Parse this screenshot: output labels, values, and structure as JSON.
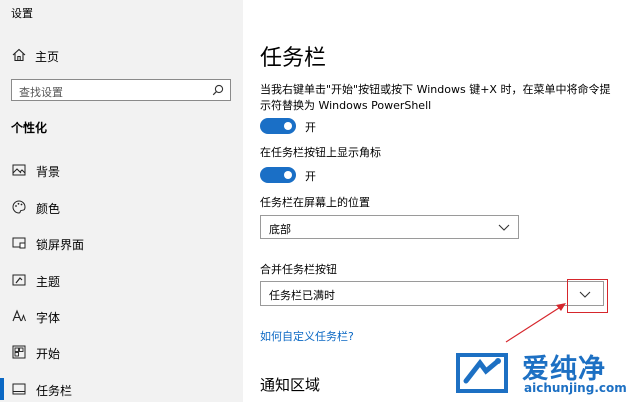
{
  "window": {
    "title": "设置"
  },
  "sidebar": {
    "home_label": "主页",
    "search_placeholder": "查找设置",
    "section": "个性化",
    "items": [
      {
        "label": "背景",
        "icon": "image-icon"
      },
      {
        "label": "颜色",
        "icon": "palette-icon"
      },
      {
        "label": "锁屏界面",
        "icon": "lockscreen-icon"
      },
      {
        "label": "主题",
        "icon": "theme-icon"
      },
      {
        "label": "字体",
        "icon": "font-icon"
      },
      {
        "label": "开始",
        "icon": "start-icon"
      },
      {
        "label": "任务栏",
        "icon": "taskbar-icon",
        "active": true
      }
    ]
  },
  "main": {
    "title": "任务栏",
    "settings": [
      {
        "label": "当我右键单击\"开始\"按钮或按下 Windows 键+X 时，在菜单中将命令提示符替换为 Windows PowerShell",
        "state": "开",
        "on": true
      },
      {
        "label": "在任务栏按钮上显示角标",
        "state": "开",
        "on": true
      }
    ],
    "position": {
      "label": "任务栏在屏幕上的位置",
      "value": "底部"
    },
    "combine": {
      "label": "合并任务栏按钮",
      "value": "任务栏已满时"
    },
    "help_link": "如何自定义任务栏?",
    "notification_title": "通知区域"
  },
  "watermark": {
    "cn": "爱纯净",
    "en": "aichunjing.com"
  },
  "colors": {
    "accent": "#1a6fc6",
    "annotation": "#d6262c",
    "sidebar_bg": "#f2f2f2"
  }
}
